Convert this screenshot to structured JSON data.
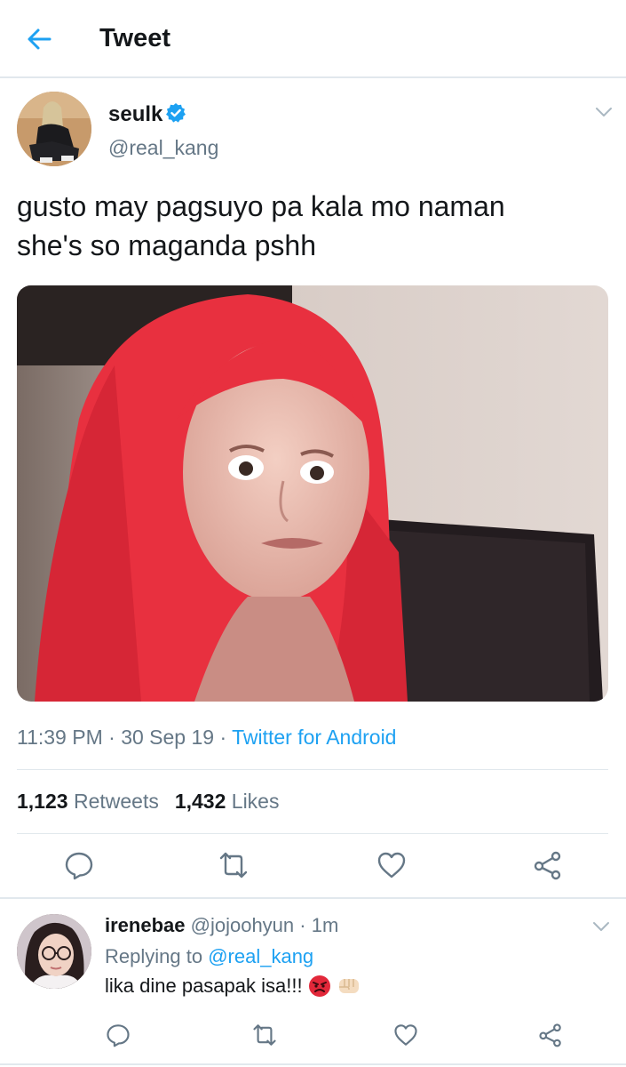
{
  "header": {
    "title": "Tweet"
  },
  "tweet": {
    "name": "seulk",
    "handle": "@real_kang",
    "text_line1": "gusto may pagsuyo pa kala mo naman",
    "text_line2": "she's so maganda pshh",
    "time": "11:39 PM",
    "date": "30 Sep 19",
    "source": "Twitter for Android",
    "retweets_count": "1,123",
    "retweets_label": "Retweets",
    "likes_count": "1,432",
    "likes_label": "Likes"
  },
  "reply": {
    "name": "irenebae",
    "handle": "@jojoohyun",
    "time": "1m",
    "replying_prefix": "Replying to",
    "replying_to": "@real_kang",
    "text": "lika dine pasapak isa!!!"
  },
  "colors": {
    "accent": "#1da1f2",
    "muted": "#657786",
    "text": "#14171a",
    "divider": "#e1e8ed",
    "hair": "#e8303f"
  }
}
